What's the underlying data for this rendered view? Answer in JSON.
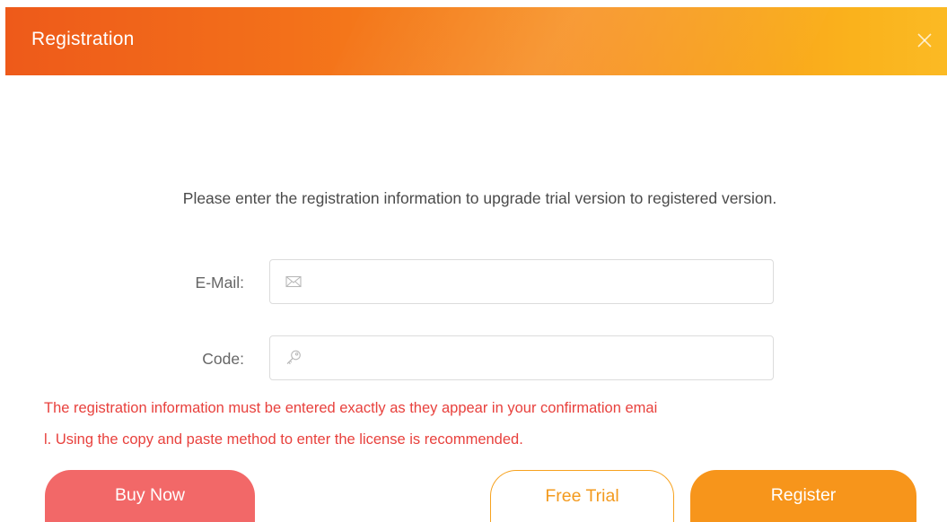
{
  "window": {
    "title": "Registration",
    "close_icon": "close-icon"
  },
  "intro_text": "Please enter the registration information to upgrade trial version to registered version.",
  "form": {
    "email": {
      "label": "E-Mail:",
      "value": "",
      "icon": "envelope-icon"
    },
    "code": {
      "label": "Code:",
      "value": "",
      "icon": "key-icon"
    }
  },
  "warning": {
    "line1": "The registration information must be entered exactly as they appear in your confirmation emai",
    "line2": "l. Using the copy and paste method to enter the license is recommended."
  },
  "buttons": {
    "buy_now": "Buy Now",
    "free_trial": "Free Trial",
    "register": "Register"
  },
  "colors": {
    "header_start": "#ee5a1a",
    "header_end": "#fbba24",
    "warning_text": "#e8413d",
    "buy_now_bg": "#f26868",
    "register_bg": "#f7951b",
    "free_trial_border": "#f7a21e"
  }
}
